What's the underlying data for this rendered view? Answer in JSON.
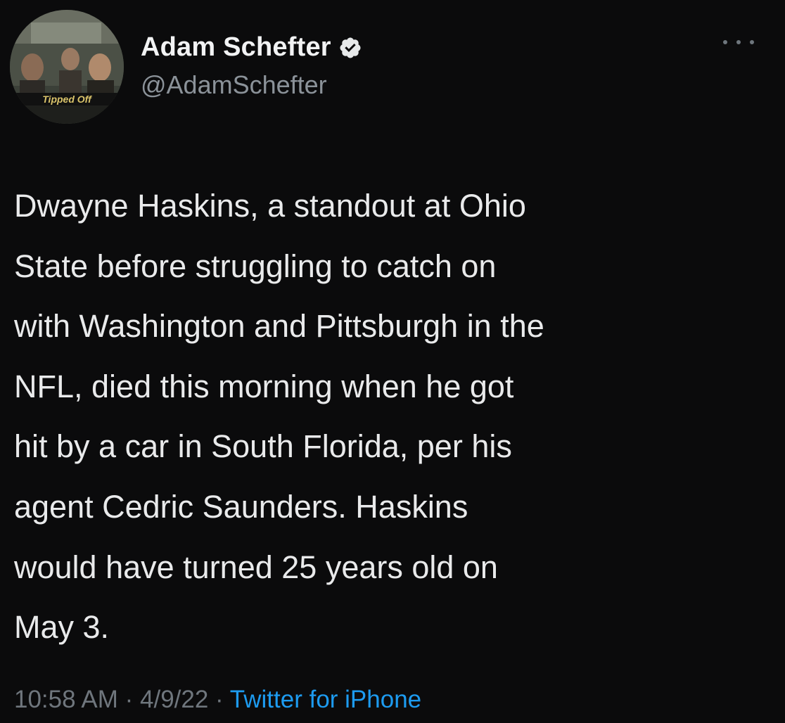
{
  "author": {
    "display_name": "Adam Schefter",
    "handle": "@AdamSchefter",
    "verified": true,
    "avatar_caption": "Tipped Off"
  },
  "menu_icon": "more-horizontal-icon",
  "tweet": {
    "text": "Dwayne Haskins, a standout at Ohio\nState before struggling to catch on\nwith Washington and Pittsburgh in the\nNFL, died this morning when he got\nhit by a car in South Florida, per his\nagent Cedric Saunders. Haskins\nwould have turned 25 years old on\nMay 3."
  },
  "meta": {
    "time": "10:58 AM",
    "separator1": " · ",
    "date": "4/9/22",
    "separator2": " · ",
    "source": "Twitter for iPhone"
  },
  "colors": {
    "background": "#0b0b0c",
    "text": "#e9eaeb",
    "muted": "#6f767d",
    "link": "#1d9bf0",
    "verified_badge": "#e7e9ea"
  }
}
